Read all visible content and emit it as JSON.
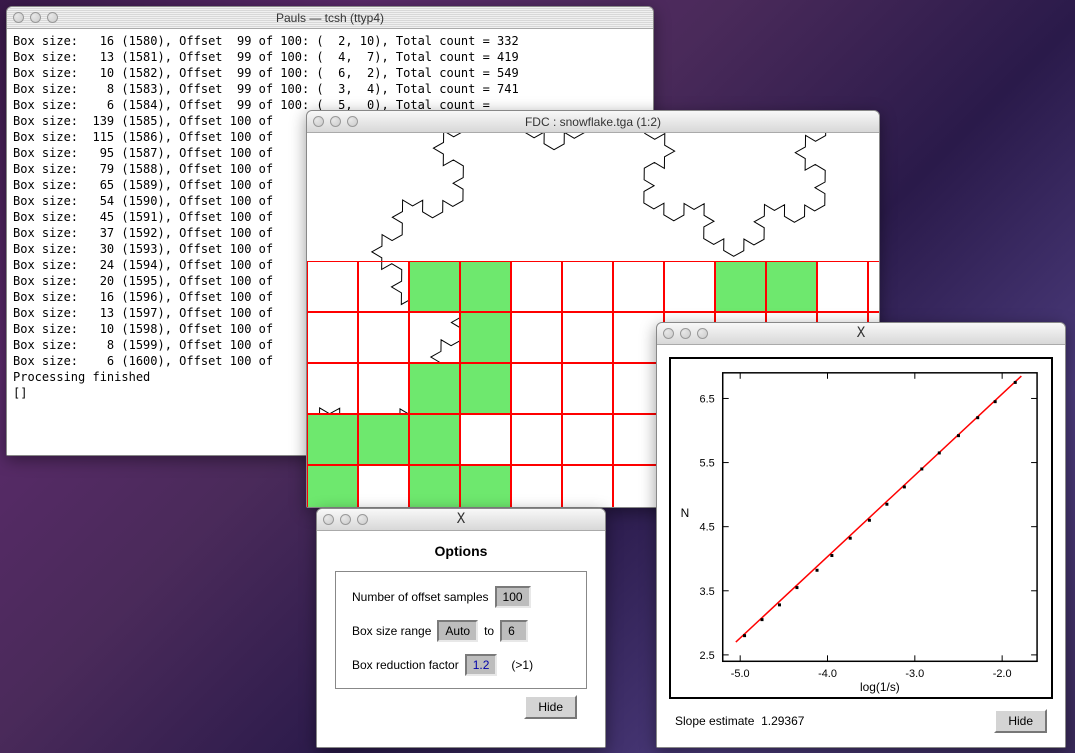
{
  "terminal": {
    "title": "Pauls — tcsh (ttyp4)",
    "lines": [
      "Box size:   16 (1580), Offset  99 of 100: (  2, 10), Total count = 332",
      "Box size:   13 (1581), Offset  99 of 100: (  4,  7), Total count = 419",
      "Box size:   10 (1582), Offset  99 of 100: (  6,  2), Total count = 549",
      "Box size:    8 (1583), Offset  99 of 100: (  3,  4), Total count = 741",
      "Box size:    6 (1584), Offset  99 of 100: (  5,  0), Total count = ",
      "Box size:  139 (1585), Offset 100 of",
      "Box size:  115 (1586), Offset 100 of",
      "Box size:   95 (1587), Offset 100 of",
      "Box size:   79 (1588), Offset 100 of",
      "Box size:   65 (1589), Offset 100 of",
      "Box size:   54 (1590), Offset 100 of",
      "Box size:   45 (1591), Offset 100 of",
      "Box size:   37 (1592), Offset 100 of",
      "Box size:   30 (1593), Offset 100 of",
      "Box size:   24 (1594), Offset 100 of",
      "Box size:   20 (1595), Offset 100 of",
      "Box size:   16 (1596), Offset 100 of",
      "Box size:   13 (1597), Offset 100 of",
      "Box size:   10 (1598), Offset 100 of",
      "Box size:    8 (1599), Offset 100 of",
      "Box size:    6 (1600), Offset 100 of",
      "Processing finished",
      "[]"
    ]
  },
  "fractal": {
    "title": "FDC : snowflake.tga (1:2)",
    "grid": {
      "cols": 12,
      "rows": 5,
      "cell": 51,
      "offsetX": 0,
      "offsetY": 128,
      "green": [
        [
          2,
          0
        ],
        [
          3,
          0
        ],
        [
          8,
          0
        ],
        [
          9,
          0
        ],
        [
          3,
          1
        ],
        [
          2,
          2
        ],
        [
          3,
          2
        ],
        [
          0,
          3
        ],
        [
          1,
          3
        ],
        [
          2,
          3
        ],
        [
          0,
          4
        ],
        [
          2,
          4
        ],
        [
          3,
          4
        ]
      ]
    }
  },
  "options": {
    "title_x": "X",
    "heading": "Options",
    "numOffsetLabel": "Number of offset samples",
    "numOffsetValue": "100",
    "boxRangeLabel": "Box size range",
    "boxRangeFrom": "Auto",
    "boxRangeToWord": "to",
    "boxRangeTo": "6",
    "boxReductionLabel": "Box reduction factor",
    "boxReductionValue": "1.2",
    "boxReductionHint": "(>1)",
    "hide": "Hide"
  },
  "plot": {
    "title_x": "X",
    "ylabel": "N",
    "xlabel": "log(1/s)",
    "slopeLabel": "Slope estimate",
    "slopeValue": "1.29367",
    "hide": "Hide",
    "yticks": [
      "6.5",
      "5.5",
      "4.5",
      "3.5",
      "2.5"
    ],
    "xticks": [
      "-5.0",
      "-4.0",
      "-3.0",
      "-2.0"
    ]
  },
  "chart_data": {
    "type": "scatter",
    "title": "",
    "xlabel": "log(1/s)",
    "ylabel": "N",
    "xlim": [
      -5.2,
      -1.6
    ],
    "ylim": [
      2.4,
      6.9
    ],
    "yticks": [
      2.5,
      3.5,
      4.5,
      5.5,
      6.5
    ],
    "xticks": [
      -5.0,
      -4.0,
      -3.0,
      -2.0
    ],
    "series": [
      {
        "name": "points",
        "x": [
          -4.95,
          -4.75,
          -4.55,
          -4.35,
          -4.12,
          -3.95,
          -3.74,
          -3.52,
          -3.32,
          -3.12,
          -2.92,
          -2.72,
          -2.5,
          -2.28,
          -2.08,
          -1.85
        ],
        "y": [
          2.8,
          3.05,
          3.28,
          3.55,
          3.82,
          4.05,
          4.32,
          4.6,
          4.85,
          5.12,
          5.4,
          5.65,
          5.92,
          6.2,
          6.45,
          6.75
        ]
      },
      {
        "name": "fit",
        "x": [
          -5.05,
          -1.78
        ],
        "y": [
          2.7,
          6.85
        ],
        "slope": 1.29367
      }
    ]
  }
}
